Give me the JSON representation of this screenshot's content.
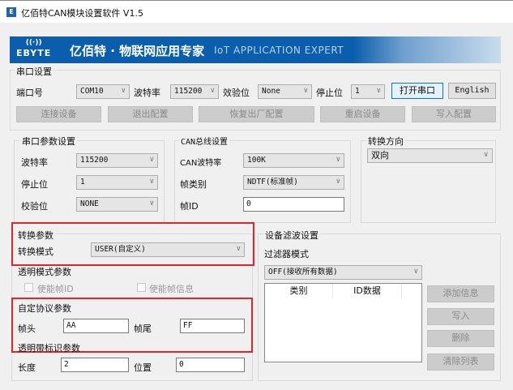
{
  "window": {
    "title": "亿佰特CAN模块设置软件 V1.5",
    "icon": "E"
  },
  "banner": {
    "logo_text": "EBYTE",
    "logo_icon": "wireless-signal-icon",
    "slogan": "亿佰特 · 物联网应用专家",
    "slogan_en": "IoT APPLICATION EXPERT",
    "brand_color": "#0b5eae"
  },
  "serial": {
    "title": "串口设置",
    "port_label": "端口号",
    "port": "COM10",
    "baud_label": "波特率",
    "baud": "115200",
    "parity_label": "效验位",
    "parity": "None",
    "stop_label": "停止位",
    "stop": "1",
    "open_button": "打开串口",
    "english_button": "English",
    "actions": [
      "连接设备",
      "退出配置",
      "恢复出厂配置",
      "重启设备",
      "写入配置"
    ]
  },
  "serial_params": {
    "title": "串口参数设置",
    "baud_label": "波特率",
    "baud": "115200",
    "stop_label": "停止位",
    "stop": "1",
    "parity_label": "校验位",
    "parity": "NONE"
  },
  "can": {
    "title": "CAN总线设置",
    "baud_label": "CAN波特率",
    "baud": "100K",
    "frame_type_label": "帧类别",
    "frame_type": "NDTF(标准帧)",
    "frame_id_label": "帧ID",
    "frame_id": "0"
  },
  "direction": {
    "title": "转换方向",
    "value": "双向"
  },
  "conversion": {
    "title": "转换参数",
    "mode_label": "转换模式",
    "mode": "USER(自定义)",
    "transparent_title": "透明模式参数",
    "enable_frame_id": "使能帧ID",
    "enable_frame_info": "使能帧信息",
    "custom_title": "自定协议参数",
    "head_label": "帧头",
    "head": "AA",
    "tail_label": "帧尾",
    "tail": "FF",
    "marked_title": "透明带标识参数",
    "length_label": "长度",
    "length": "2",
    "position_label": "位置",
    "position": "0"
  },
  "filter": {
    "title": "设备滤波设置",
    "mode_label": "过滤器模式",
    "mode": "OFF(接收所有数据)",
    "columns": [
      "类别",
      "ID数据"
    ],
    "buttons": [
      "添加信息",
      "写入",
      "删除",
      "清除列表"
    ]
  },
  "highlight_color": "#e0262a"
}
